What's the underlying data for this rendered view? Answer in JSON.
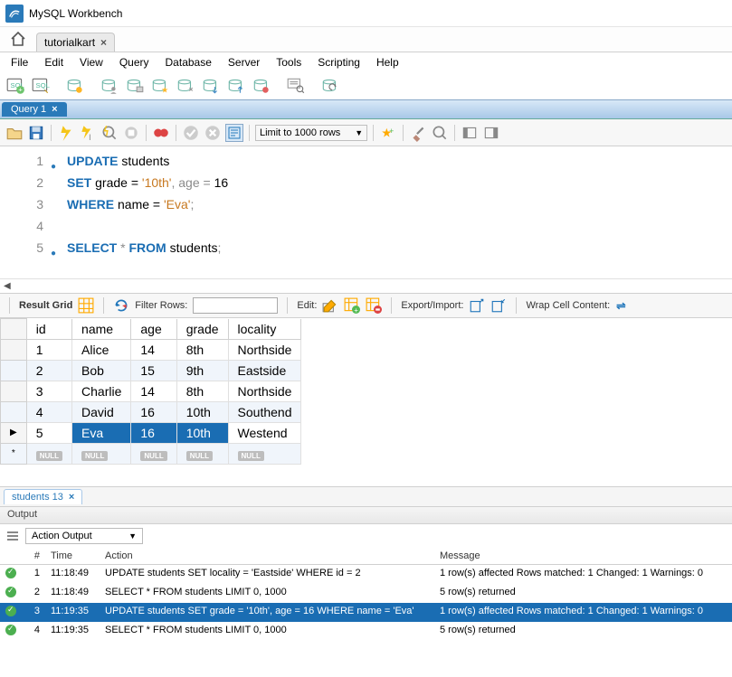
{
  "window": {
    "title": "MySQL Workbench"
  },
  "connection_tab": {
    "label": "tutorialkart"
  },
  "menu": [
    "File",
    "Edit",
    "View",
    "Query",
    "Database",
    "Server",
    "Tools",
    "Scripting",
    "Help"
  ],
  "query_tab": {
    "label": "Query 1"
  },
  "limit_label": "Limit to 1000 rows",
  "sql": {
    "line1_kw1": "UPDATE",
    "line1_id": " students",
    "line2_kw1": "SET",
    "line2_rest": " grade = ",
    "line2_str": "'10th'",
    "line2_mid": ", age = ",
    "line2_num": "16",
    "line3_kw1": "WHERE",
    "line3_rest": " name = ",
    "line3_str": "'Eva'",
    "line3_end": ";",
    "line5_kw1": "SELECT",
    "line5_star": " * ",
    "line5_kw2": "FROM",
    "line5_id": " students",
    "line5_end": ";"
  },
  "gridbar": {
    "result_grid": "Result Grid",
    "filter": "Filter Rows:",
    "edit": "Edit:",
    "exportimport": "Export/Import:",
    "wrap": "Wrap Cell Content:"
  },
  "columns": [
    "id",
    "name",
    "age",
    "grade",
    "locality"
  ],
  "rows": [
    {
      "id": "1",
      "name": "Alice",
      "age": "14",
      "grade": "8th",
      "locality": "Northside"
    },
    {
      "id": "2",
      "name": "Bob",
      "age": "15",
      "grade": "9th",
      "locality": "Eastside"
    },
    {
      "id": "3",
      "name": "Charlie",
      "age": "14",
      "grade": "8th",
      "locality": "Northside"
    },
    {
      "id": "4",
      "name": "David",
      "age": "16",
      "grade": "10th",
      "locality": "Southend"
    },
    {
      "id": "5",
      "name": "Eva",
      "age": "16",
      "grade": "10th",
      "locality": "Westend"
    }
  ],
  "null_label": "NULL",
  "result_tab": "students 13",
  "output_label": "Output",
  "action_output": "Action Output",
  "log_headers": [
    "#",
    "Time",
    "Action",
    "Message"
  ],
  "log": [
    {
      "n": "1",
      "time": "11:18:49",
      "action": "UPDATE students SET locality = 'Eastside' WHERE id = 2",
      "msg": "1 row(s) affected Rows matched: 1  Changed: 1  Warnings: 0"
    },
    {
      "n": "2",
      "time": "11:18:49",
      "action": "SELECT * FROM students LIMIT 0, 1000",
      "msg": "5 row(s) returned"
    },
    {
      "n": "3",
      "time": "11:19:35",
      "action": "UPDATE students SET grade = '10th', age = 16 WHERE name = 'Eva'",
      "msg": "1 row(s) affected Rows matched: 1  Changed: 1  Warnings: 0"
    },
    {
      "n": "4",
      "time": "11:19:35",
      "action": "SELECT * FROM students LIMIT 0, 1000",
      "msg": "5 row(s) returned"
    }
  ]
}
